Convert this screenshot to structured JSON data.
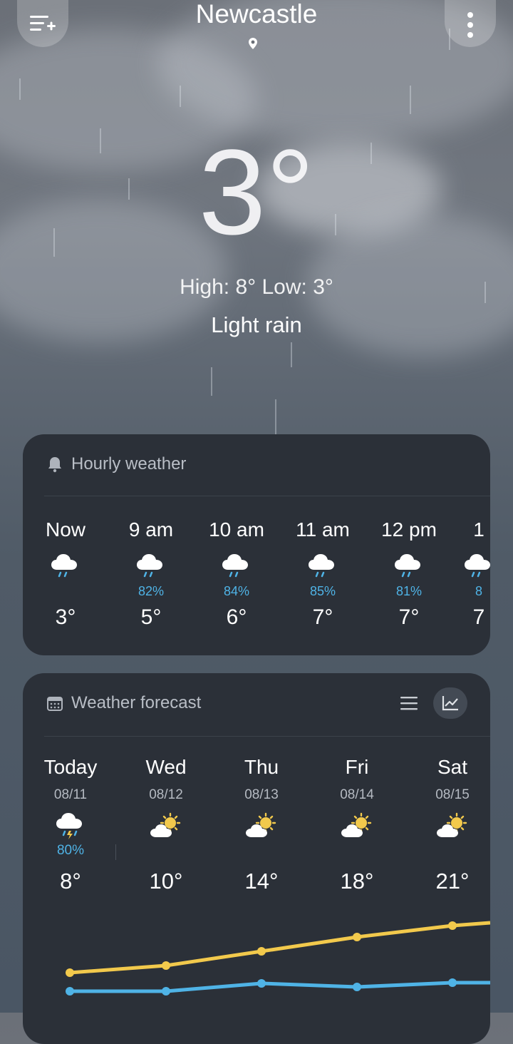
{
  "location": {
    "city": "Newcastle"
  },
  "current": {
    "temp": "3°",
    "high_low": "High: 8° Low: 3°",
    "condition": "Light rain"
  },
  "hourly": {
    "title": "Hourly weather",
    "items": [
      {
        "time": "Now",
        "precip": "",
        "temp": "3°",
        "icon": "rain-icon"
      },
      {
        "time": "9 am",
        "precip": "82%",
        "temp": "5°",
        "icon": "rain-icon"
      },
      {
        "time": "10 am",
        "precip": "84%",
        "temp": "6°",
        "icon": "rain-icon"
      },
      {
        "time": "11 am",
        "precip": "85%",
        "temp": "7°",
        "icon": "rain-icon"
      },
      {
        "time": "12 pm",
        "precip": "81%",
        "temp": "7°",
        "icon": "rain-icon"
      },
      {
        "time": "1",
        "precip": "8",
        "temp": "7",
        "icon": "rain-icon"
      }
    ]
  },
  "forecast": {
    "title": "Weather forecast",
    "days": [
      {
        "day": "Today",
        "date": "08/11",
        "precip": "80%",
        "high": "8°",
        "icon": "thunderstorm-icon"
      },
      {
        "day": "Wed",
        "date": "08/12",
        "precip": "",
        "high": "10°",
        "icon": "partly-sunny-icon"
      },
      {
        "day": "Thu",
        "date": "08/13",
        "precip": "",
        "high": "14°",
        "icon": "partly-sunny-icon"
      },
      {
        "day": "Fri",
        "date": "08/14",
        "precip": "",
        "high": "18°",
        "icon": "partly-sunny-icon"
      },
      {
        "day": "Sat",
        "date": "08/15",
        "precip": "",
        "high": "21°",
        "icon": "partly-sunny-icon"
      }
    ],
    "high_color": "#f2c94c",
    "low_color": "#4fb3e6"
  },
  "colors": {
    "card_bg": "#2b3038",
    "precip": "#4fb3e6"
  }
}
